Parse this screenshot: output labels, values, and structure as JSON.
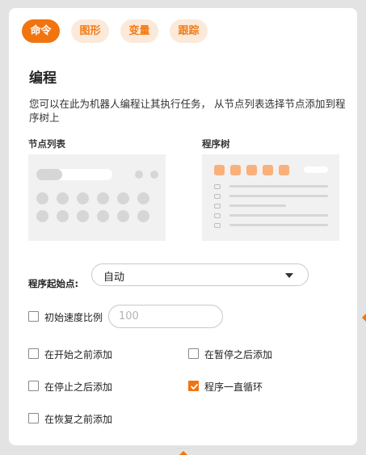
{
  "tabs": [
    {
      "label": "命令",
      "active": true
    },
    {
      "label": "图形",
      "active": false
    },
    {
      "label": "变量",
      "active": false
    },
    {
      "label": "跟踪",
      "active": false
    }
  ],
  "section": {
    "title": "编程",
    "description": "您可以在此为机器人编程让其执行任务， 从节点列表选择节点添加到程序树上"
  },
  "panels": {
    "node_list_label": "节点列表",
    "program_tree_label": "程序树"
  },
  "start_point": {
    "label": "程序起始点:",
    "selected": "自动"
  },
  "initial_speed": {
    "label": "初始速度比例",
    "placeholder": "100",
    "checked": false
  },
  "options": {
    "before_start": {
      "label": "在开始之前添加",
      "checked": false
    },
    "after_pause": {
      "label": "在暂停之后添加",
      "checked": false
    },
    "after_stop": {
      "label": "在停止之后添加",
      "checked": false
    },
    "loop_program": {
      "label": "程序一直循环",
      "checked": true
    },
    "before_resume": {
      "label": "在恢复之前添加",
      "checked": false
    }
  },
  "colors": {
    "accent": "#f2740f",
    "tab_inactive_bg": "#fbe9da",
    "placeholder_gray": "#d6d6d6"
  }
}
